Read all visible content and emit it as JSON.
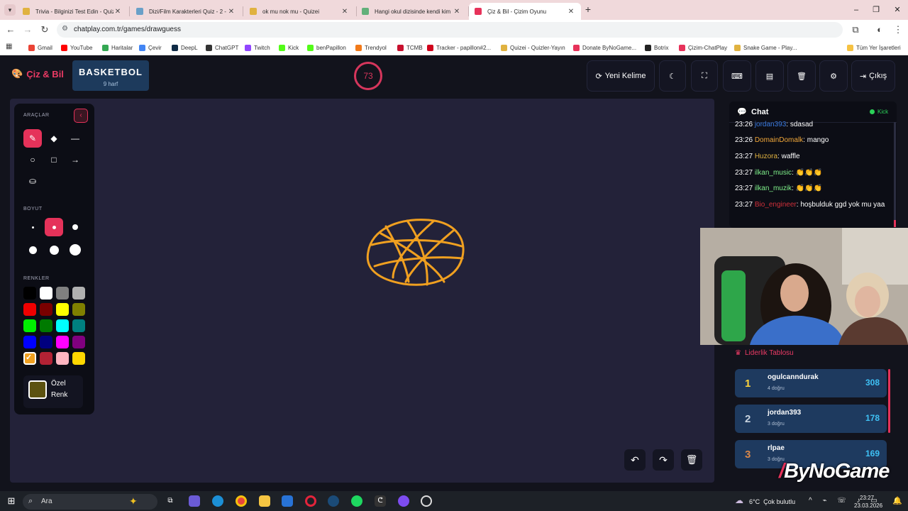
{
  "browser": {
    "tabs": [
      {
        "title": "Trivia - Bilginizi Test Edin - Quiz",
        "color": "#e0b240"
      },
      {
        "title": "Dizi/Film Karakterleri Quiz - 2 -",
        "color": "#6aa0c8"
      },
      {
        "title": "ok mu nok mu - Quizei",
        "color": "#e0b240"
      },
      {
        "title": "Hangi okul dizisinde kendi kim",
        "color": "#62b07a"
      },
      {
        "title": "Çiz & Bil - Çizim Oyunu",
        "color": "#e7325a"
      }
    ],
    "new_tab": "+",
    "url": "chatplay.com.tr/games/drawguess",
    "bookmarks": [
      {
        "label": "Gmail",
        "color": "#ea4335"
      },
      {
        "label": "YouTube",
        "color": "#ff0000"
      },
      {
        "label": "Haritalar",
        "color": "#34a853"
      },
      {
        "label": "Çevir",
        "color": "#4285f4"
      },
      {
        "label": "DeepL",
        "color": "#0f2b46"
      },
      {
        "label": "ChatGPT",
        "color": "#333333"
      },
      {
        "label": "Twitch",
        "color": "#9146ff"
      },
      {
        "label": "Kick",
        "color": "#53fc18"
      },
      {
        "label": "benPapillon",
        "color": "#53fc18"
      },
      {
        "label": "Trendyol",
        "color": "#f27a1a"
      },
      {
        "label": "TCMB",
        "color": "#c8102e"
      },
      {
        "label": "Tracker - papillon#2...",
        "color": "#d0021b"
      },
      {
        "label": "Quizei - Quizler-Yayın",
        "color": "#e0b240"
      },
      {
        "label": "Donate ByNoGame...",
        "color": "#e7325a"
      },
      {
        "label": "Botrix",
        "color": "#222222"
      },
      {
        "label": "Çizim-ChatPlay",
        "color": "#e7325a"
      },
      {
        "label": "Snake Game - Play...",
        "color": "#e0b240"
      }
    ],
    "all_bookmarks": "Tüm Yer İşaretleri"
  },
  "app": {
    "brand": "Çiz & Bil",
    "word": "BASKETBOL",
    "word_hint": "9 harf",
    "timer": "73",
    "buttons": {
      "new_word": "Yeni Kelime",
      "exit": "Çıkış"
    }
  },
  "tools": {
    "title": "ARAÇLAR",
    "size_title": "BOYUT",
    "colors_title": "RENKLER",
    "custom_color_label": "Özel Renk",
    "colors": [
      "#000000",
      "#ffffff",
      "#808080",
      "#b0b0b0",
      "#ee0000",
      "#7a0000",
      "#ffff00",
      "#7f8000",
      "#00ee00",
      "#007a00",
      "#00ffff",
      "#008080",
      "#0000ff",
      "#00007f",
      "#ff00ff",
      "#80007f",
      "#f0a020",
      "#b22234",
      "#ffb6c1",
      "#ffd700"
    ],
    "selected_color": "#f0a020"
  },
  "chat": {
    "title": "Chat",
    "source": "Kick",
    "messages": [
      {
        "time": "23:26",
        "user": "jordan393",
        "color": "#3a7be0",
        "text": "sdasad"
      },
      {
        "time": "23:26",
        "user": "DomainDomalk",
        "color": "#f2a83a",
        "text": "mango"
      },
      {
        "time": "23:27",
        "user": "Huzora",
        "color": "#e0b240",
        "text": "waffle"
      },
      {
        "time": "23:27",
        "user": "ilkan_music",
        "color": "#7ff08a",
        "text": "👏👏👏"
      },
      {
        "time": "23:27",
        "user": "ilkan_muzik",
        "color": "#7ff08a",
        "text": "👏👏👏"
      },
      {
        "time": "23:27",
        "user": "Bio_engineer",
        "color": "#d0303a",
        "text": "hoşbulduk ggd yok mu yaa"
      }
    ]
  },
  "leaderboard": {
    "title": "Liderlik Tablosu",
    "rows": [
      {
        "rank": "1",
        "name": "ogulcanndurak",
        "sub": "4 doğru",
        "score": "308",
        "rank_color": "#ffd43b"
      },
      {
        "rank": "2",
        "name": "jordan393",
        "sub": "3 doğru",
        "score": "178",
        "rank_color": "#c7d2de"
      },
      {
        "rank": "3",
        "name": "rlpae",
        "sub": "3 doğru",
        "score": "169",
        "rank_color": "#d9874a"
      }
    ]
  },
  "overlay": {
    "logo": "ByNoGame"
  },
  "taskbar": {
    "search": "Ara",
    "weather": "6°C  Çok bulutlu",
    "time": "23:27",
    "date": "23.03.2026"
  },
  "drawing": {
    "stroke_color": "#f0a020"
  }
}
